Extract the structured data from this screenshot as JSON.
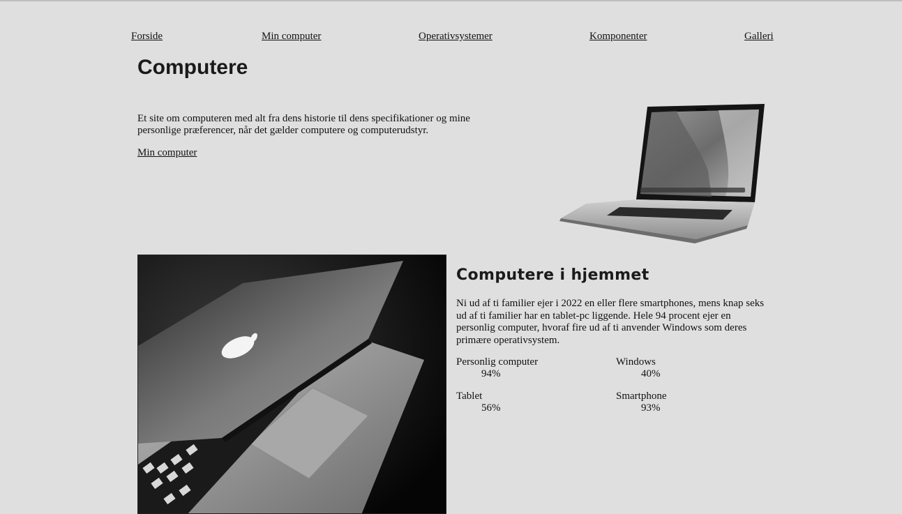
{
  "nav": {
    "items": [
      "Forside",
      "Min computer",
      "Operativsystemer",
      "Komponenter",
      "Galleri"
    ]
  },
  "header": {
    "title": "Computere"
  },
  "intro": {
    "text": "Et site om computeren med alt fra dens historie til dens specifikationer og mine personlige præferencer, når det gælder computere og computerudstyr.",
    "link_label": "Min computer"
  },
  "section": {
    "title": "Computere i hjemmet",
    "text": "Ni ud af ti familier ejer i 2022 en eller flere smartphones, mens knap seks ud af ti familier har en tablet-pc liggende. Hele 94 procent ejer en personlig computer, hvoraf fire ud af ti anvender Windows som deres primære operativsystem.",
    "stats": [
      {
        "label": "Personlig computer",
        "value": "94%"
      },
      {
        "label": "Windows",
        "value": "40%"
      },
      {
        "label": "Tablet",
        "value": "56%"
      },
      {
        "label": "Smartphone",
        "value": "93%"
      }
    ]
  },
  "icons": {
    "hero": "laptop-image",
    "photo": "macbook-photo"
  },
  "colors": {
    "background": "#dfdfdf",
    "text": "#111111"
  }
}
